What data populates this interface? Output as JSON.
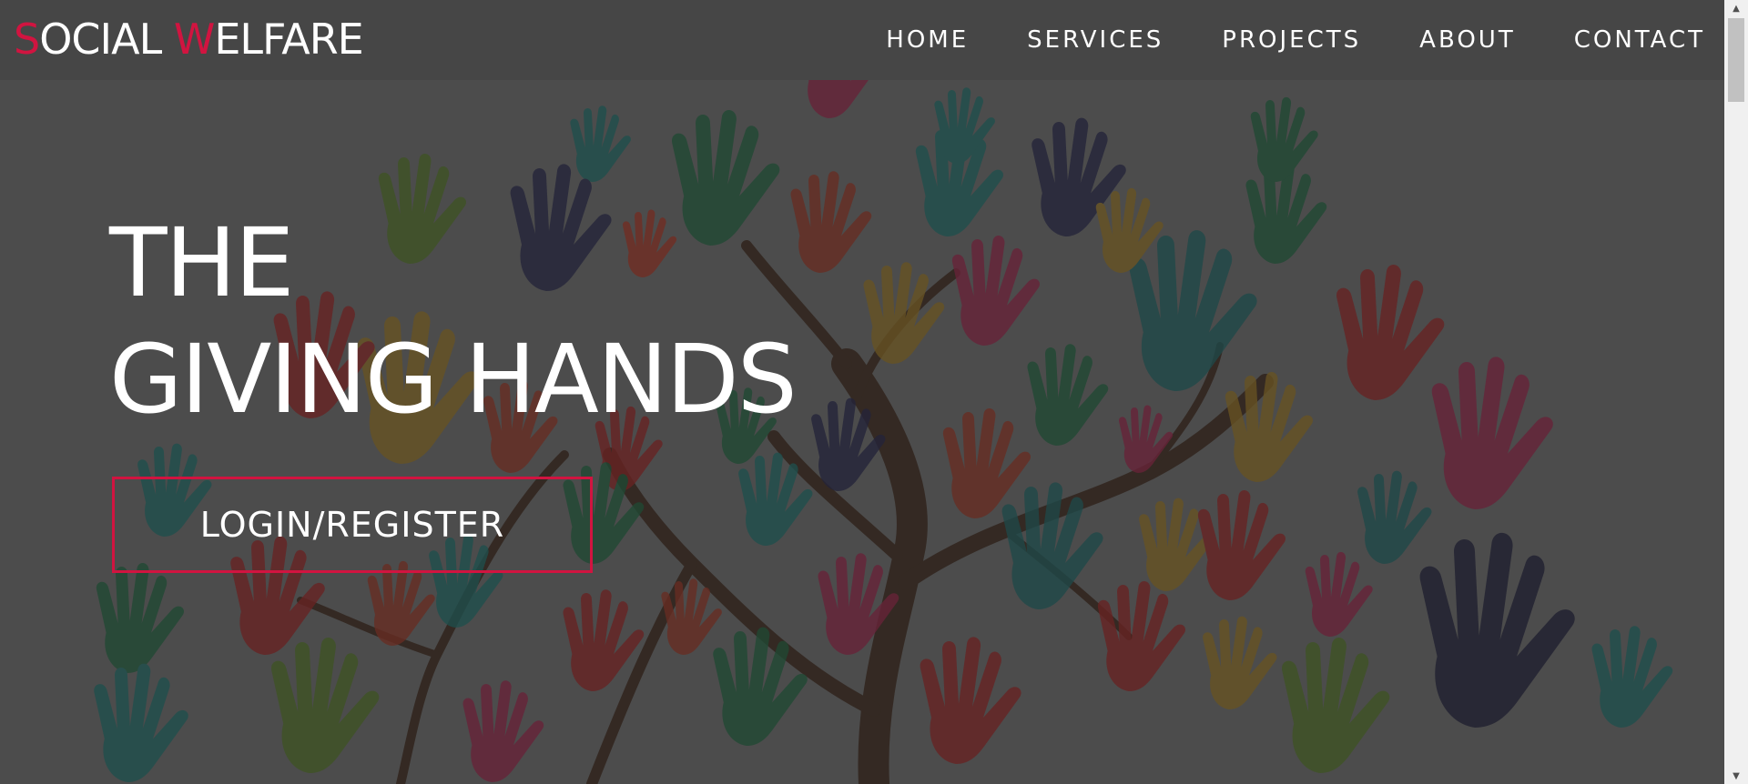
{
  "brand": {
    "logo_parts": [
      "S",
      "OCIAL ",
      "W",
      "ELFARE"
    ],
    "accent_color": "#d11440"
  },
  "nav": {
    "items": [
      {
        "label": "HOME"
      },
      {
        "label": "SERVICES"
      },
      {
        "label": "PROJECTS"
      },
      {
        "label": "ABOUT"
      },
      {
        "label": "CONTACT"
      }
    ]
  },
  "hero": {
    "title_line1": "THE",
    "title_line2": "GIVING HANDS",
    "cta_label": "LOGIN/REGISTER",
    "background": "tree-of-colorful-hands-illustration"
  },
  "scrollbar": {
    "up_icon": "scroll-up-arrow-icon",
    "down_icon": "scroll-down-arrow-icon"
  }
}
